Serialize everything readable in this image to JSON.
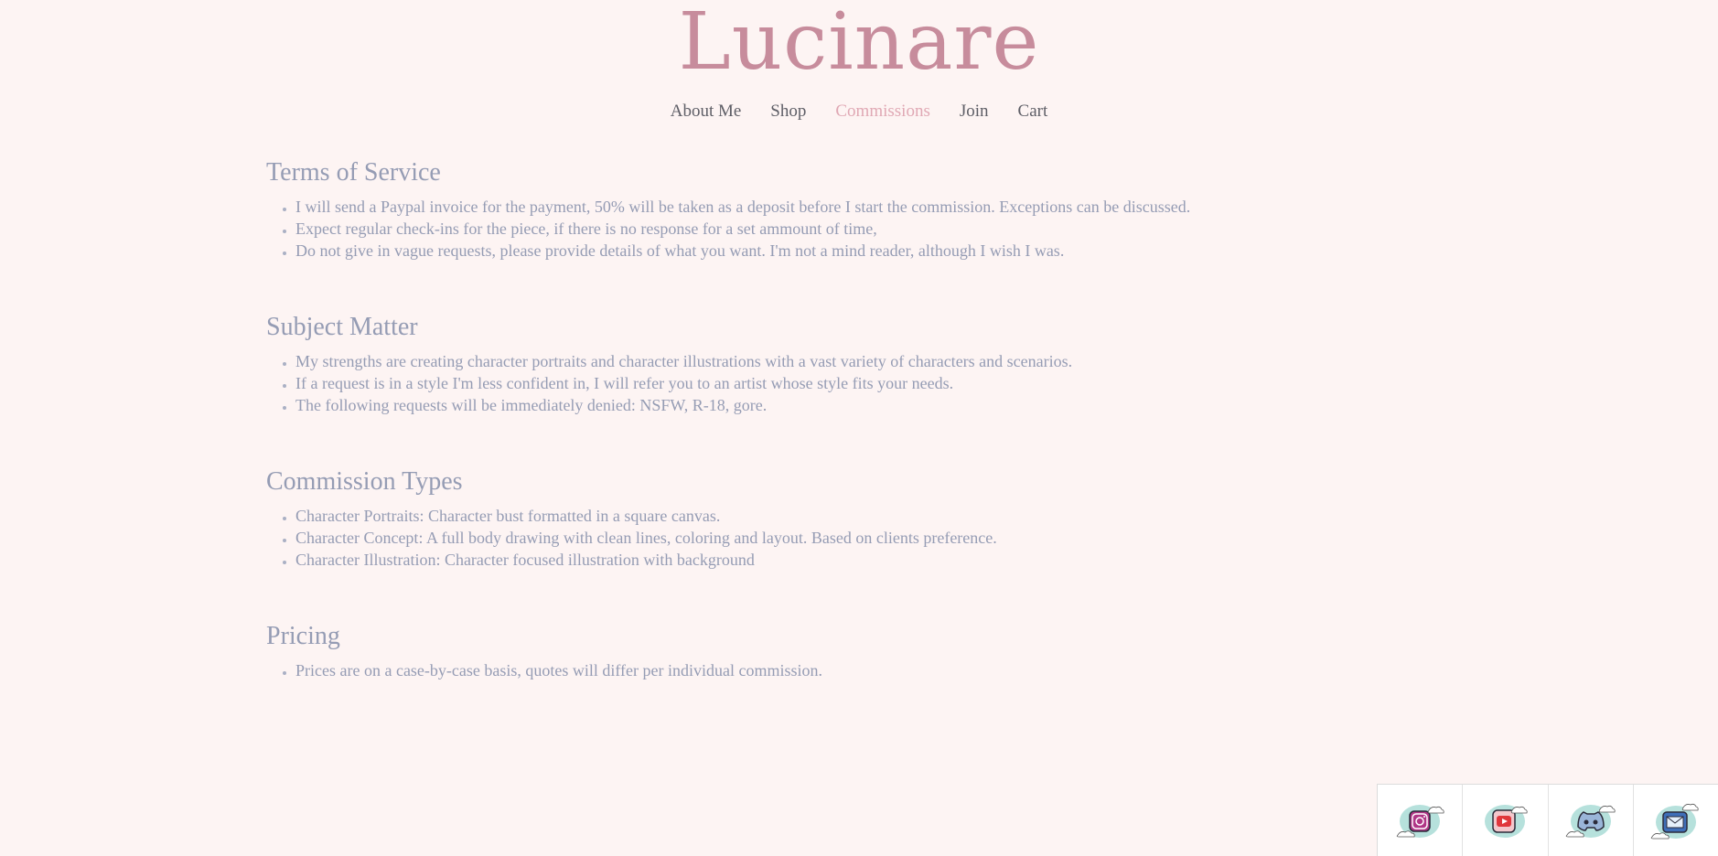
{
  "site": {
    "logo": "Lucinare"
  },
  "nav": {
    "items": [
      {
        "label": "About Me"
      },
      {
        "label": "Shop"
      },
      {
        "label": "Commissions"
      },
      {
        "label": "Join"
      },
      {
        "label": "Cart"
      }
    ],
    "active": "Commissions"
  },
  "sections": [
    {
      "title": "Terms of Service",
      "items": [
        "I will send a Paypal invoice for the payment, 50% will be taken as a deposit before I start the commission. Exceptions can be discussed.",
        "Expect regular check-ins for the piece, if there is no response for a set ammount of time,",
        "Do not give in vague requests, please provide details of what you want. I'm not a mind reader, although I wish I was."
      ]
    },
    {
      "title": "Subject Matter",
      "items": [
        "My strengths are creating character portraits and character illustrations with a vast variety of characters and scenarios.",
        "If a request is in a style I'm less confident in, I will refer you to an artist whose style fits your needs.",
        "The following requests will be immediately denied: NSFW, R-18, gore."
      ]
    },
    {
      "title": "Commission Types",
      "items": [
        "Character Portraits: Character bust formatted in a square canvas.",
        "Character Concept: A full body drawing with clean lines, coloring and layout. Based on clients preference.",
        "Character Illustration: Character focused illustration with background"
      ]
    },
    {
      "title": "Pricing",
      "items": [
        "Prices are on a case-by-case basis, quotes will differ per individual commission."
      ]
    }
  ],
  "social": {
    "items": [
      {
        "icon": "instagram-icon"
      },
      {
        "icon": "youtube-icon"
      },
      {
        "icon": "discord-icon"
      },
      {
        "icon": "mail-icon"
      }
    ]
  },
  "colors": {
    "background": "#fdf4f3",
    "logo": "#c78c9c",
    "nav_text": "#5e5e66",
    "nav_active": "#e0a8b4",
    "body_text": "#959cb4"
  }
}
